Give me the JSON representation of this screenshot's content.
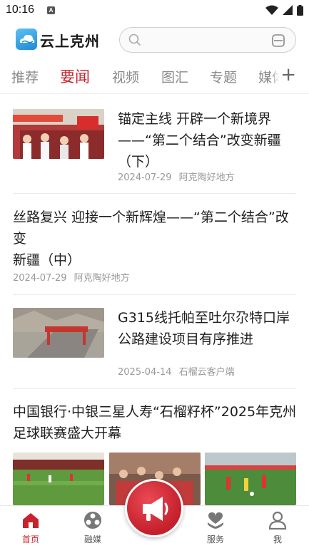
{
  "status_bar": {
    "time": "10:16",
    "notification_badge": "A"
  },
  "header": {
    "app_name": "云上克州",
    "search_placeholder": ""
  },
  "tabs": [
    {
      "label": "推荐",
      "active": false
    },
    {
      "label": "要闻",
      "active": true
    },
    {
      "label": "视频",
      "active": false
    },
    {
      "label": "图汇",
      "active": false
    },
    {
      "label": "专题",
      "active": false
    },
    {
      "label": "媒体",
      "active": false
    }
  ],
  "tab_add_label": "+",
  "news": [
    {
      "title_line1": "锚定主线 开辟一个新境界",
      "title_line2": "——“第二个结合”改变新疆",
      "title_line3": "（下）",
      "date": "2024-07-29",
      "source": "阿克陶好地方"
    },
    {
      "title_line1": "丝路复兴 迎接一个新辉煌——“第二个结合”改变",
      "title_line2": "新疆（中）",
      "date": "2024-07-29",
      "source": "阿克陶好地方"
    },
    {
      "title_line1": "G315线托帕至吐尔尕特口岸",
      "title_line2": "公路建设项目有序推进",
      "date": "2025-04-14",
      "source": "石榴云客户端"
    },
    {
      "title_line1": "中国银行·中银三星人寿“石榴籽杯”2025年克州",
      "title_line2": "足球联赛盛大开幕"
    }
  ],
  "bottom_nav": [
    {
      "label": "首页",
      "icon": "home-icon",
      "active": true
    },
    {
      "label": "融媒",
      "icon": "media-icon",
      "active": false
    },
    {
      "label": "服务",
      "icon": "service-icon",
      "active": false
    },
    {
      "label": "我",
      "icon": "profile-icon",
      "active": false
    }
  ],
  "colors": {
    "accent": "#c8232c",
    "logo_blue": "#1c8ad6"
  }
}
